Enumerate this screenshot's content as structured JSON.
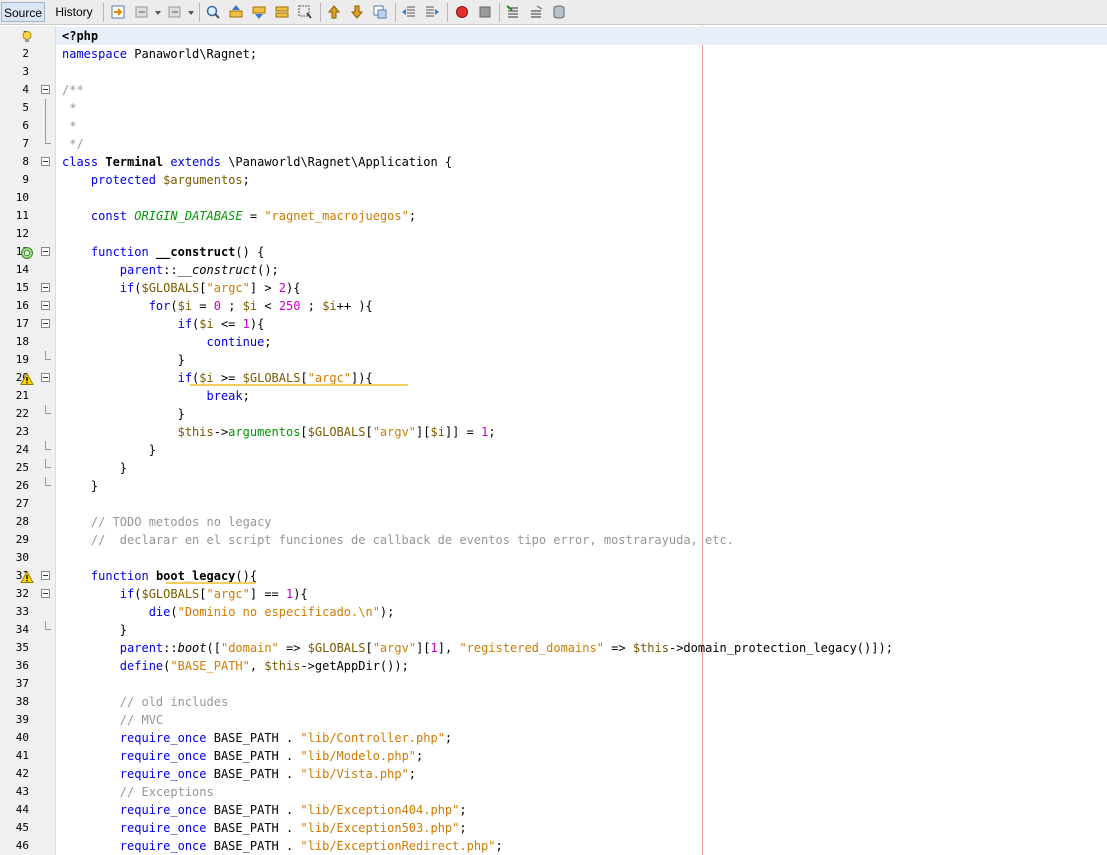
{
  "toolbar": {
    "tabs": [
      {
        "label": "Source",
        "active": true
      },
      {
        "label": "History",
        "active": false
      }
    ],
    "icons": [
      "last-edit-icon",
      "back-icon",
      "forward-icon",
      "find-icon",
      "find-previous-icon",
      "find-next-icon",
      "find-selection-icon",
      "toggle-highlight-icon",
      "previous-bookmark-icon",
      "next-bookmark-icon",
      "toggle-bookmark-icon",
      "shift-left-icon",
      "shift-right-icon",
      "start-macro-icon",
      "stop-macro-icon",
      "comment-icon",
      "uncomment-icon",
      "database-icon"
    ]
  },
  "editor": {
    "language": "php",
    "current_line": 1,
    "right_margin_column": 80,
    "lines": [
      {
        "n": "1",
        "text": "<?php"
      },
      {
        "n": "2",
        "text": "namespace Panaworld\\Ragnet;"
      },
      {
        "n": "3",
        "text": ""
      },
      {
        "n": "4",
        "text": "/**"
      },
      {
        "n": "5",
        "text": " *"
      },
      {
        "n": "6",
        "text": " *"
      },
      {
        "n": "7",
        "text": " */"
      },
      {
        "n": "8",
        "text": "class Terminal extends \\Panaworld\\Ragnet\\Application {"
      },
      {
        "n": "9",
        "text": "    protected $argumentos;"
      },
      {
        "n": "10",
        "text": ""
      },
      {
        "n": "11",
        "text": "    const ORIGIN_DATABASE = \"ragnet_macrojuegos\";"
      },
      {
        "n": "12",
        "text": ""
      },
      {
        "n": "13",
        "text": "    function __construct() {"
      },
      {
        "n": "14",
        "text": "        parent::__construct();"
      },
      {
        "n": "15",
        "text": "        if($GLOBALS[\"argc\"] > 2){"
      },
      {
        "n": "16",
        "text": "            for($i = 0 ; $i < 250 ; $i++ ){"
      },
      {
        "n": "17",
        "text": "                if($i <= 1){"
      },
      {
        "n": "18",
        "text": "                    continue;"
      },
      {
        "n": "19",
        "text": "                }"
      },
      {
        "n": "20",
        "text": "                if($i >= $GLOBALS[\"argc\"]){"
      },
      {
        "n": "21",
        "text": "                    break;"
      },
      {
        "n": "22",
        "text": "                }"
      },
      {
        "n": "23",
        "text": "                $this->argumentos[$GLOBALS[\"argv\"][$i]] = 1;"
      },
      {
        "n": "24",
        "text": "            }"
      },
      {
        "n": "25",
        "text": "        }"
      },
      {
        "n": "26",
        "text": "    }"
      },
      {
        "n": "27",
        "text": ""
      },
      {
        "n": "28",
        "text": "    // TODO metodos no legacy"
      },
      {
        "n": "29",
        "text": "    //  declarar en el script funciones de callback de eventos tipo error, mostrarayuda, etc."
      },
      {
        "n": "30",
        "text": ""
      },
      {
        "n": "31",
        "text": "    function boot_legacy(){"
      },
      {
        "n": "32",
        "text": "        if($GLOBALS[\"argc\"] == 1){"
      },
      {
        "n": "33",
        "text": "            die(\"Dominio no especificado.\\n\");"
      },
      {
        "n": "34",
        "text": "        }"
      },
      {
        "n": "35",
        "text": "        parent::boot([\"domain\" => $GLOBALS[\"argv\"][1], \"registered_domains\" => $this->domain_protection_legacy()]);"
      },
      {
        "n": "36",
        "text": "        define(\"BASE_PATH\", $this->getAppDir());"
      },
      {
        "n": "37",
        "text": ""
      },
      {
        "n": "38",
        "text": "        // old includes"
      },
      {
        "n": "39",
        "text": "        // MVC"
      },
      {
        "n": "40",
        "text": "        require_once BASE_PATH . \"lib/Controller.php\";"
      },
      {
        "n": "41",
        "text": "        require_once BASE_PATH . \"lib/Modelo.php\";"
      },
      {
        "n": "42",
        "text": "        require_once BASE_PATH . \"lib/Vista.php\";"
      },
      {
        "n": "43",
        "text": "        // Exceptions"
      },
      {
        "n": "44",
        "text": "        require_once BASE_PATH . \"lib/Exception404.php\";"
      },
      {
        "n": "45",
        "text": "        require_once BASE_PATH . \"lib/Exception503.php\";"
      },
      {
        "n": "46",
        "text": "        require_once BASE_PATH . \"lib/ExceptionRedirect.php\";"
      }
    ],
    "gutter_markers": [
      {
        "line": "1",
        "icon": "lightbulb-icon"
      },
      {
        "line": "13",
        "icon": "override-icon"
      },
      {
        "line": "20",
        "icon": "warning-icon"
      },
      {
        "line": "31",
        "icon": "warning-icon"
      }
    ]
  },
  "colors": {
    "keyword": "#0000e6",
    "string": "#ce7b00",
    "number": "#c800c8",
    "variable": "#7a5a00",
    "comment": "#969696",
    "constant": "#009900"
  }
}
